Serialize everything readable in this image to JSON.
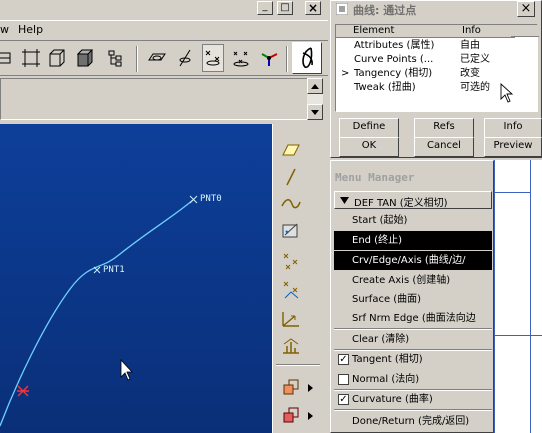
{
  "menubar": {
    "item_w": "w",
    "help": "Help"
  },
  "window_controls": {
    "minimize": "_",
    "maximize": "□",
    "close": "×"
  },
  "graphics": {
    "points": [
      {
        "label": "PNT0"
      },
      {
        "label": "PNT1"
      }
    ]
  },
  "curve_dialog": {
    "title": "曲线: 通过点",
    "columns": {
      "element": "Element",
      "info": "Info"
    },
    "rows": [
      {
        "element": "Attributes (属性)",
        "info": "自由",
        "current": false
      },
      {
        "element": "Curve Points (...",
        "info": "已定义",
        "current": false
      },
      {
        "element": "Tangency (相切)",
        "info": "改变",
        "current": true
      },
      {
        "element": "Tweak (扭曲)",
        "info": "可选的",
        "current": false
      }
    ],
    "current_marker": ">",
    "buttons": {
      "define": "Define",
      "refs": "Refs",
      "info": "Info",
      "ok": "OK",
      "cancel": "Cancel",
      "preview": "Preview"
    }
  },
  "menu_manager": {
    "title": "Menu Manager",
    "section": "DEF TAN (定义相切)",
    "items": [
      {
        "label": "Start (起始)",
        "selected": false
      },
      {
        "label": "End (终止)",
        "selected": true
      },
      {
        "label": "Crv/Edge/Axis (曲线/边/",
        "selected": true
      },
      {
        "label": "Create Axis (创建轴)",
        "selected": false
      },
      {
        "label": "Surface (曲面)",
        "selected": false
      },
      {
        "label": "Srf Nrm Edge (曲面法向边",
        "selected": false
      },
      {
        "label": "Clear (清除)",
        "selected": false
      }
    ],
    "checkboxes": [
      {
        "label": "Tangent (相切)",
        "checked": true
      },
      {
        "label": "Normal (法向)",
        "checked": false
      },
      {
        "label": "Curvature (曲率)",
        "checked": true
      }
    ],
    "done_return": "Done/Return (完成/返回)"
  },
  "colors": {
    "viewport_top": "#0d3f9a",
    "viewport_bottom": "#0a2f78",
    "curve": "#6fd0ff",
    "point_marker": "#c8f0ff",
    "start_marker": "#ff3030",
    "selection": "#000000",
    "face": "#d4d0c8"
  }
}
